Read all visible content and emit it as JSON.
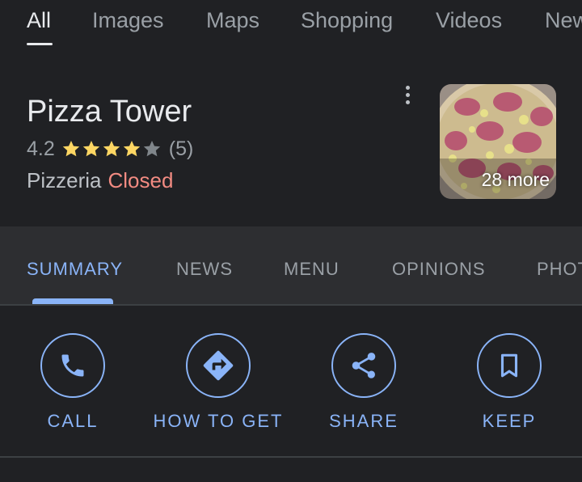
{
  "top_tabs": [
    {
      "label": "All",
      "active": true
    },
    {
      "label": "Images"
    },
    {
      "label": "Maps"
    },
    {
      "label": "Shopping"
    },
    {
      "label": "Videos"
    },
    {
      "label": "News"
    }
  ],
  "place": {
    "name": "Pizza Tower",
    "rating": "4.2",
    "stars": 4.2,
    "review_count": "(5)",
    "category": "Pizzeria",
    "status": "Closed",
    "photo_more": "28 more"
  },
  "section_tabs": [
    {
      "label": "SUMMARY",
      "active": true
    },
    {
      "label": "NEWS"
    },
    {
      "label": "MENU"
    },
    {
      "label": "OPINIONS"
    },
    {
      "label": "PHOTOS"
    }
  ],
  "actions": [
    {
      "label": "CALL",
      "icon": "phone-icon"
    },
    {
      "label": "HOW TO GET",
      "icon": "directions-icon"
    },
    {
      "label": "SHARE",
      "icon": "share-icon"
    },
    {
      "label": "KEEP",
      "icon": "bookmark-icon"
    }
  ],
  "colors": {
    "background": "#202124",
    "accent": "#8ab4f8",
    "closed": "#f28b82",
    "star": "#fdd663"
  }
}
